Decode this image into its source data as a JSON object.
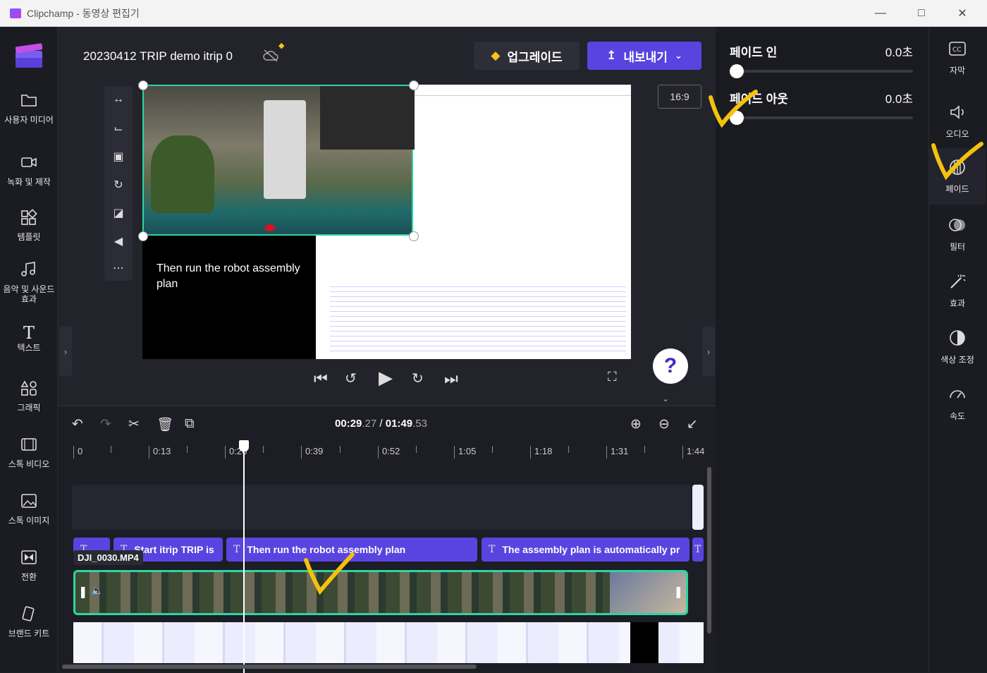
{
  "window": {
    "title": "Clipchamp - 동영상 편집기"
  },
  "sidebar": {
    "items": [
      {
        "label": "사용자 미디어"
      },
      {
        "label": "녹화 및 제작"
      },
      {
        "label": "템플릿"
      },
      {
        "label": "음악 및 사운드 효과"
      },
      {
        "label": "텍스트"
      },
      {
        "label": "그래픽"
      },
      {
        "label": "스톡 비디오"
      },
      {
        "label": "스톡 이미지"
      },
      {
        "label": "전환"
      },
      {
        "label": "브랜드 키트"
      }
    ]
  },
  "header": {
    "project_title": "20230412 TRIP demo itrip 0",
    "upgrade_label": "업그레이드",
    "export_label": "내보내기"
  },
  "preview": {
    "aspect_ratio": "16:9",
    "caption": "Then run the robot assembly plan",
    "help_label": "?"
  },
  "timeline": {
    "time_current": "00:29",
    "time_current_frac": ".27",
    "time_sep": " / ",
    "time_total": "01:49",
    "time_total_frac": ".53",
    "ruler": [
      "0",
      "0:13",
      "0:26",
      "0:39",
      "0:52",
      "1:05",
      "1:18",
      "1:31",
      "1:44"
    ],
    "text_clips": [
      {
        "label": ""
      },
      {
        "label": "Start itrip TRIP is"
      },
      {
        "label": "Then run the robot assembly plan"
      },
      {
        "label": "The assembly plan is automatically pr"
      }
    ],
    "video_clip_name": "DJI_0030.MP4"
  },
  "properties": {
    "fade_in": {
      "label": "페이드 인",
      "value": "0.0초",
      "level": 0
    },
    "fade_out": {
      "label": "페이드 아웃",
      "value": "0.0초",
      "level": 0
    }
  },
  "right_rail": {
    "items": [
      {
        "label": "자막"
      },
      {
        "label": "오디오"
      },
      {
        "label": "페이드"
      },
      {
        "label": "필터"
      },
      {
        "label": "효과"
      },
      {
        "label": "색상 조정"
      },
      {
        "label": "속도"
      }
    ]
  },
  "colors": {
    "accent": "#5a44e0",
    "clip_selected": "#2ed5a0",
    "annotation": "#f4c20d"
  }
}
